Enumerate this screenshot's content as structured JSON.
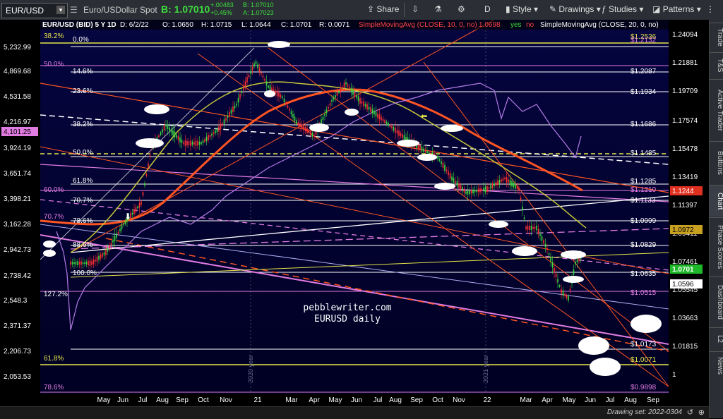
{
  "toolbar": {
    "symbol": "EUR/USD",
    "instrument_name": "Euro/USDollar Spot",
    "bid": "B: 1.07010",
    "change": "+.00483",
    "change_pct": "+0.45%",
    "bid_small": "B: 1.07010",
    "ask_small": "A: 1.07023",
    "share": "Share",
    "period": "D",
    "style": "Style",
    "drawings": "Drawings",
    "studies": "Studies",
    "patterns": "Patterns"
  },
  "header": {
    "title": "EUR/USD (BID) 5 Y 1D",
    "date": "D: 6/2/22",
    "open": "O: 1.0650",
    "high": "H: 1.0715",
    "low": "L: 1.0644",
    "close": "C: 1.0701",
    "range": "R: 0.0071",
    "sma10": "SimpleMovingAvg (CLOSE, 10, 0, no)",
    "sma10_val": "1.0698",
    "yes": "yes",
    "no": "no",
    "sma20": "SimpleMovingAvg (CLOSE, 20, 0, no)"
  },
  "right_rail": [
    "Trade",
    "T&S",
    "Active Trader",
    "Buttons",
    "Chart",
    "Phase Scores",
    "Dashboard",
    "L2",
    "News"
  ],
  "left_axis": {
    "ticks": [
      "5,232.99",
      "4,869.68",
      "4,531.58",
      "4,216.97",
      "3,924.19",
      "3,651.74",
      "3,398.21",
      "3,162.28",
      "2,942.73",
      "2,738.42",
      "2,548.3",
      "2,371.37",
      "2,206.73",
      "2,053.53"
    ],
    "highlight": "4,101.25"
  },
  "right_axis": {
    "ticks": [
      "1.24094",
      "1.21881",
      "1.19709",
      "1.17574",
      "1.15478",
      "1.13419",
      "1.11397",
      "1.09411",
      "1.07461",
      "1.05545",
      "1.03663",
      "1.01815",
      "1"
    ],
    "last_price": "1.0701",
    "sma_label": "1.0972",
    "red_label": "1.1244",
    "white_label": "1.0596"
  },
  "fib_left": [
    {
      "text": "38.2%",
      "color": "#e5e54a"
    },
    {
      "text": "50.0%",
      "color": "#e07be0"
    },
    {
      "text": "60.0%",
      "color": "#e07be0"
    },
    {
      "text": "70.7%",
      "color": "#e07be0"
    },
    {
      "text": "127.2%",
      "color": "#ffffff"
    },
    {
      "text": "61.8%",
      "color": "#e5e54a"
    },
    {
      "text": "78.6%",
      "color": "#e07be0"
    }
  ],
  "fib_inner": [
    "0.0%",
    "14.6%",
    "23.6%",
    "38.2%",
    "50.0%",
    "61.8%",
    "70.7%",
    "78.6%",
    "88.6%",
    "100.0%"
  ],
  "fib_right": [
    {
      "text": "$1.2536",
      "color": "#e5e54a"
    },
    {
      "text": "$1.2132",
      "color": "#e07be0"
    },
    {
      "text": "$1.2087",
      "color": "#ffffff"
    },
    {
      "text": "$1.1934",
      "color": "#ffffff"
    },
    {
      "text": "$1.1686",
      "color": "#ffffff"
    },
    {
      "text": "$1.1485",
      "color": "#ffffff"
    },
    {
      "text": "$1.1285",
      "color": "#ffffff"
    },
    {
      "text": "$1.1210",
      "color": "#e07be0"
    },
    {
      "text": "$1.1133",
      "color": "#ffffff"
    },
    {
      "text": "$1.0999",
      "color": "#ffffff"
    },
    {
      "text": "$1.0829",
      "color": "#ffffff"
    },
    {
      "text": "$1.0635",
      "color": "#ffffff"
    },
    {
      "text": "$1.0515",
      "color": "#e07be0"
    },
    {
      "text": "$1.0173",
      "color": "#ffffff"
    },
    {
      "text": "$1.0071",
      "color": "#e5e54a"
    },
    {
      "text": "$0.9898",
      "color": "#e07be0"
    }
  ],
  "x_axis": [
    "May",
    "Jun",
    "Jul",
    "Aug",
    "Sep",
    "Oct",
    "Nov",
    "21",
    "Mar",
    "Apr",
    "May",
    "Jun",
    "Jul",
    "Aug",
    "Sep",
    "Oct",
    "Nov",
    "22",
    "Mar",
    "Apr",
    "May",
    "Jun",
    "Jul",
    "Aug",
    "Sep"
  ],
  "year_markers": [
    "2020 year",
    "2021 year"
  ],
  "watermark": {
    "site": "pebblewriter.com",
    "subtitle": "EURUSD daily"
  },
  "drawing_set": "Drawing set: 2022-0304"
}
